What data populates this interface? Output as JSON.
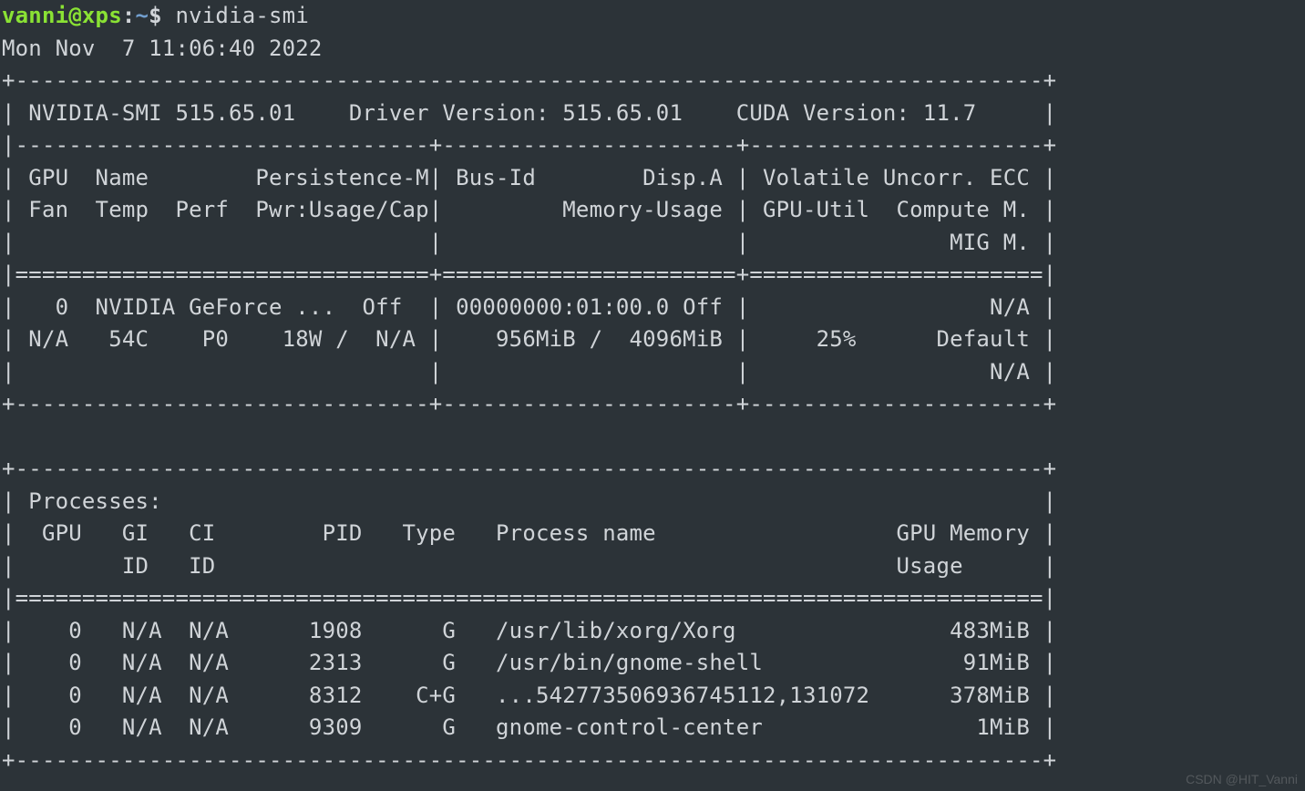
{
  "prompt": {
    "user": "vanni",
    "at": "@",
    "host": "xps",
    "sep": ":",
    "path": "~",
    "dollar": "$ ",
    "command": "nvidia-smi"
  },
  "timestamp": "Mon Nov  7 11:06:40 2022",
  "smi": {
    "top_border": "+-----------------------------------------------------------------------------+",
    "header_line": "| NVIDIA-SMI 515.65.01    Driver Version: 515.65.01    CUDA Version: 11.7     |",
    "sep1": "|-------------------------------+----------------------+----------------------+",
    "col_hdr_1": "| GPU  Name        Persistence-M| Bus-Id        Disp.A | Volatile Uncorr. ECC |",
    "col_hdr_2": "| Fan  Temp  Perf  Pwr:Usage/Cap|         Memory-Usage | GPU-Util  Compute M. |",
    "col_hdr_3": "|                               |                      |               MIG M. |",
    "sep2": "|===============================+======================+======================|",
    "row_1": "|   0  NVIDIA GeForce ...  Off  | 00000000:01:00.0 Off |                  N/A |",
    "row_2": "| N/A   54C    P0    18W /  N/A |    956MiB /  4096MiB |     25%      Default |",
    "row_3": "|                               |                      |                  N/A |",
    "bottom_split": "+-------------------------------+----------------------+----------------------+",
    "blank": "                                                                               ",
    "proc_top": "+-----------------------------------------------------------------------------+",
    "proc_title": "| Processes:                                                                  |",
    "proc_hdr_1": "|  GPU   GI   CI        PID   Type   Process name                  GPU Memory |",
    "proc_hdr_2": "|        ID   ID                                                   Usage      |",
    "proc_sep": "|=============================================================================|",
    "proc_r1": "|    0   N/A  N/A      1908      G   /usr/lib/xorg/Xorg                483MiB |",
    "proc_r2": "|    0   N/A  N/A      2313      G   /usr/bin/gnome-shell               91MiB |",
    "proc_r3": "|    0   N/A  N/A      8312    C+G   ...542773506936745112,131072      378MiB |",
    "proc_r4": "|    0   N/A  N/A      9309      G   gnome-control-center                1MiB |",
    "proc_bottom": "+-----------------------------------------------------------------------------+"
  },
  "smi_version": "515.65.01",
  "driver_version": "515.65.01",
  "cuda_version": "11.7",
  "gpus": [
    {
      "index": 0,
      "name": "NVIDIA GeForce ...",
      "persistence_m": "Off",
      "bus_id": "00000000:01:00.0",
      "disp_a": "Off",
      "ecc": "N/A",
      "fan": "N/A",
      "temp": "54C",
      "perf": "P0",
      "pwr_usage": "18W",
      "pwr_cap": "N/A",
      "mem_used": "956MiB",
      "mem_total": "4096MiB",
      "gpu_util": "25%",
      "compute_mode": "Default",
      "mig_mode": "N/A"
    }
  ],
  "processes": [
    {
      "gpu": 0,
      "gi_id": "N/A",
      "ci_id": "N/A",
      "pid": 1908,
      "type": "G",
      "name": "/usr/lib/xorg/Xorg",
      "mem": "483MiB"
    },
    {
      "gpu": 0,
      "gi_id": "N/A",
      "ci_id": "N/A",
      "pid": 2313,
      "type": "G",
      "name": "/usr/bin/gnome-shell",
      "mem": "91MiB"
    },
    {
      "gpu": 0,
      "gi_id": "N/A",
      "ci_id": "N/A",
      "pid": 8312,
      "type": "C+G",
      "name": "...542773506936745112,131072",
      "mem": "378MiB"
    },
    {
      "gpu": 0,
      "gi_id": "N/A",
      "ci_id": "N/A",
      "pid": 9309,
      "type": "G",
      "name": "gnome-control-center",
      "mem": "1MiB"
    }
  ],
  "watermark": "CSDN @HIT_Vanni"
}
